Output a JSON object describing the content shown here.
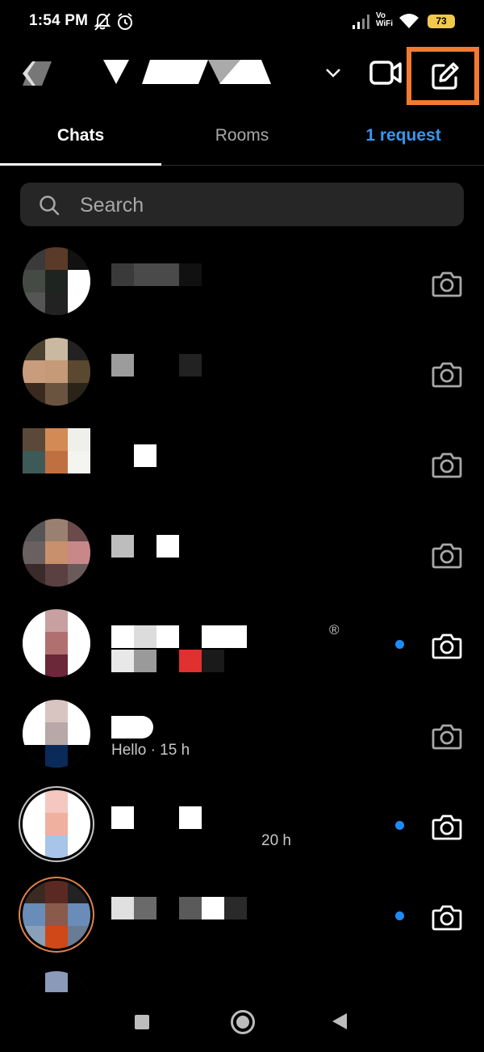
{
  "status_bar": {
    "time": "1:54 PM",
    "volte": "Vo\nWiFi",
    "battery": "73",
    "icons": [
      "mute-bell-icon",
      "alarm-icon",
      "signal-icon",
      "wifi-icon",
      "battery-icon"
    ]
  },
  "header": {
    "back_icon": "back-arrow-icon",
    "account_name_icon": "redacted-username",
    "chevron_icon": "chevron-down-icon",
    "video_icon": "video-camera-icon",
    "compose_icon": "compose-edit-icon",
    "highlight_color": "#f47a30"
  },
  "tabs": [
    {
      "label": "Chats",
      "active": true
    },
    {
      "label": "Rooms",
      "active": false
    },
    {
      "label": "1 request",
      "active": false,
      "color": "#3797f0"
    }
  ],
  "search": {
    "placeholder": "Search"
  },
  "chats": [
    {
      "sub": "",
      "unread": false,
      "story": false
    },
    {
      "sub": "",
      "unread": false,
      "story": false
    },
    {
      "sub": "",
      "unread": false,
      "story": false
    },
    {
      "sub": "",
      "unread": false,
      "story": false
    },
    {
      "sub": "®",
      "unread": true,
      "story": false
    },
    {
      "sub": "Hello · 15 h",
      "unread": false,
      "story": false
    },
    {
      "sub": "20 h",
      "unread": true,
      "story": true
    },
    {
      "sub": "",
      "unread": true,
      "story": true
    }
  ],
  "colors": {
    "background": "#000000",
    "accent_blue": "#3797f0",
    "unread_dot": "#1d8cf8",
    "search_bg": "#262626"
  }
}
